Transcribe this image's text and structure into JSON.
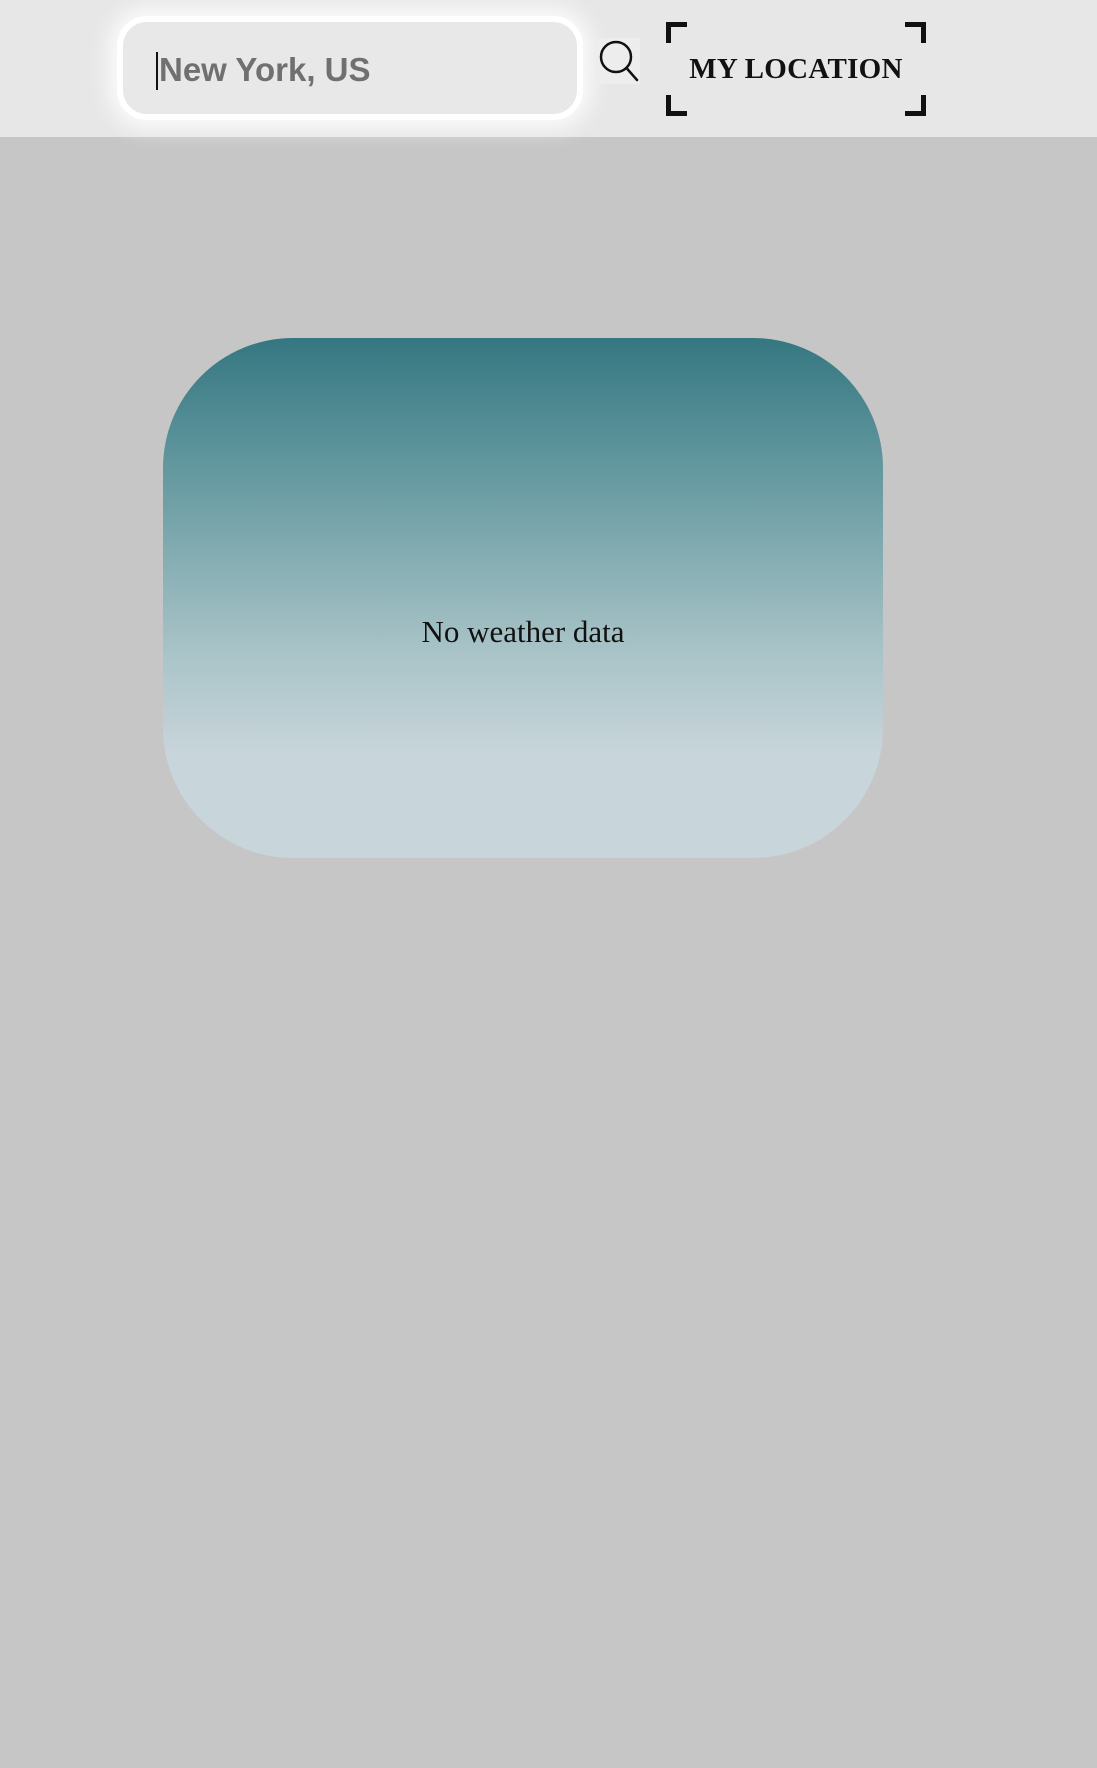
{
  "header": {
    "search": {
      "value": "New York, US",
      "placeholder": "New York, US"
    },
    "search_button_icon": "search-icon",
    "my_location_label": "MY LOCATION"
  },
  "weather_card": {
    "message": "No weather data"
  },
  "colors": {
    "page_background": "#c6c6c6",
    "header_background": "#e7e7e7",
    "card_gradient_top": "#357781",
    "card_gradient_bottom": "#c8d5da"
  }
}
